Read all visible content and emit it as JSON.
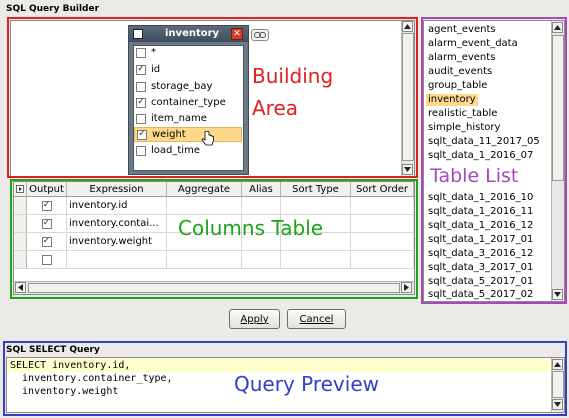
{
  "builder": {
    "title": "SQL Query Builder"
  },
  "table_window": {
    "title": "inventory",
    "fields": [
      {
        "label": "*",
        "checked": false
      },
      {
        "label": "id",
        "checked": true
      },
      {
        "label": "storage_bay",
        "checked": false
      },
      {
        "label": "container_type",
        "checked": true
      },
      {
        "label": "item_name",
        "checked": false
      },
      {
        "label": "weight",
        "checked": true,
        "highlighted": true
      },
      {
        "label": "load_time",
        "checked": false
      }
    ]
  },
  "annotations": {
    "building_area_line1": "Building",
    "building_area_line2": "Area",
    "columns_table": "Columns Table",
    "table_list": "Table List",
    "query_preview": "Query Preview"
  },
  "columns_table": {
    "headers": [
      "Output",
      "Expression",
      "Aggregate",
      "Alias",
      "Sort Type",
      "Sort Order"
    ],
    "rows": [
      {
        "output": true,
        "expression": "inventory.id"
      },
      {
        "output": true,
        "expression": "inventory.contai..."
      },
      {
        "output": true,
        "expression": "inventory.weight"
      },
      {
        "output": false,
        "expression": ""
      }
    ]
  },
  "table_list": {
    "items": [
      "agent_events",
      "alarm_event_data",
      "alarm_events",
      "audit_events",
      "group_table",
      "inventory",
      "realistic_table",
      "simple_history",
      "sqlt_data_11_2017_05",
      "sqlt_data_1_2016_07",
      "sqlt_data_1_2016_10",
      "sqlt_data_1_2016_11",
      "sqlt_data_1_2016_12",
      "sqlt_data_1_2017_01",
      "sqlt_data_3_2016_12",
      "sqlt_data_3_2017_01",
      "sqlt_data_5_2017_01",
      "sqlt_data_5_2017_02"
    ],
    "selected": "inventory"
  },
  "buttons": {
    "apply": "Apply",
    "cancel": "Cancel"
  },
  "query": {
    "title": "SQL SELECT Query",
    "lines": [
      "SELECT inventory.id,",
      "  inventory.container_type,",
      "  inventory.weight"
    ]
  },
  "colors": {
    "selection": "#ffd98a",
    "red": "#e02020",
    "green": "#1aa51a",
    "purple": "#a548b8",
    "blue": "#3040c8"
  }
}
